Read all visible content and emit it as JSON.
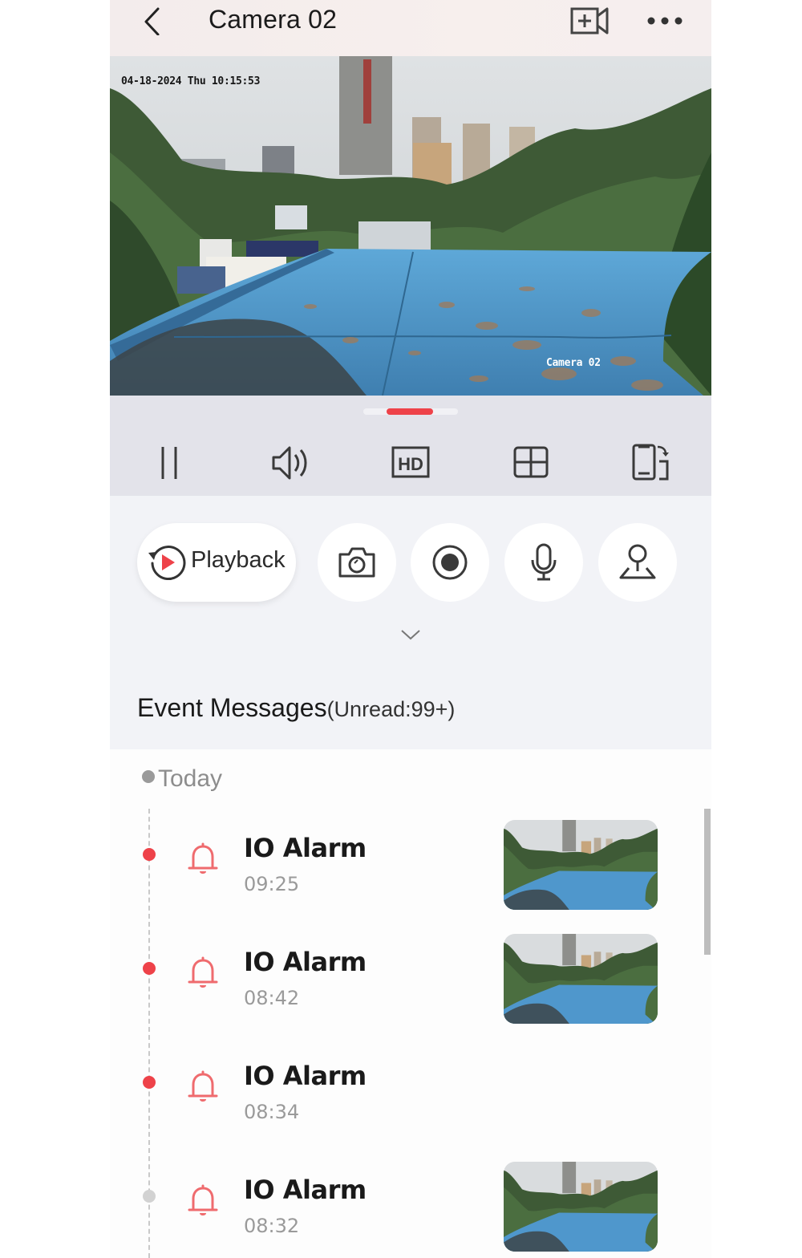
{
  "header": {
    "title": "Camera 02",
    "back_icon": "chevron-left-icon",
    "add_camera_icon": "video-add-icon",
    "more_icon": "more-dots-icon"
  },
  "video": {
    "osd_timestamp": "04-18-2024 Thu 10:15:53",
    "osd_camera_name": "Camera 02",
    "page_indicator": {
      "pages": 2,
      "active": 1
    }
  },
  "controls": [
    {
      "id": "pause",
      "icon": "pause-icon"
    },
    {
      "id": "sound",
      "icon": "speaker-icon"
    },
    {
      "id": "quality",
      "icon": "hd-icon",
      "label": "HD"
    },
    {
      "id": "layout",
      "icon": "grid-icon"
    },
    {
      "id": "rotate",
      "icon": "phone-rotate-icon"
    }
  ],
  "actions": {
    "playback_label": "Playback",
    "buttons": [
      {
        "id": "snapshot",
        "icon": "camera-icon"
      },
      {
        "id": "record",
        "icon": "record-icon"
      },
      {
        "id": "talk",
        "icon": "microphone-icon"
      },
      {
        "id": "ptz",
        "icon": "joystick-icon"
      }
    ],
    "expand_icon": "chevron-down-icon"
  },
  "events": {
    "title": "Event Messages",
    "unread": "(Unread:99+)",
    "day_label": "Today",
    "items": [
      {
        "name": "IO Alarm",
        "time": "09:25",
        "unread": true,
        "has_thumbnail": true
      },
      {
        "name": "IO Alarm",
        "time": "08:42",
        "unread": true,
        "has_thumbnail": true
      },
      {
        "name": "IO Alarm",
        "time": "08:34",
        "unread": true,
        "has_thumbnail": false
      },
      {
        "name": "IO Alarm",
        "time": "08:32",
        "unread": false,
        "has_thumbnail": true
      }
    ]
  },
  "colors": {
    "accent": "#ee4249",
    "bell": "#ef6b6e",
    "read_dot": "#d2d2d2"
  }
}
